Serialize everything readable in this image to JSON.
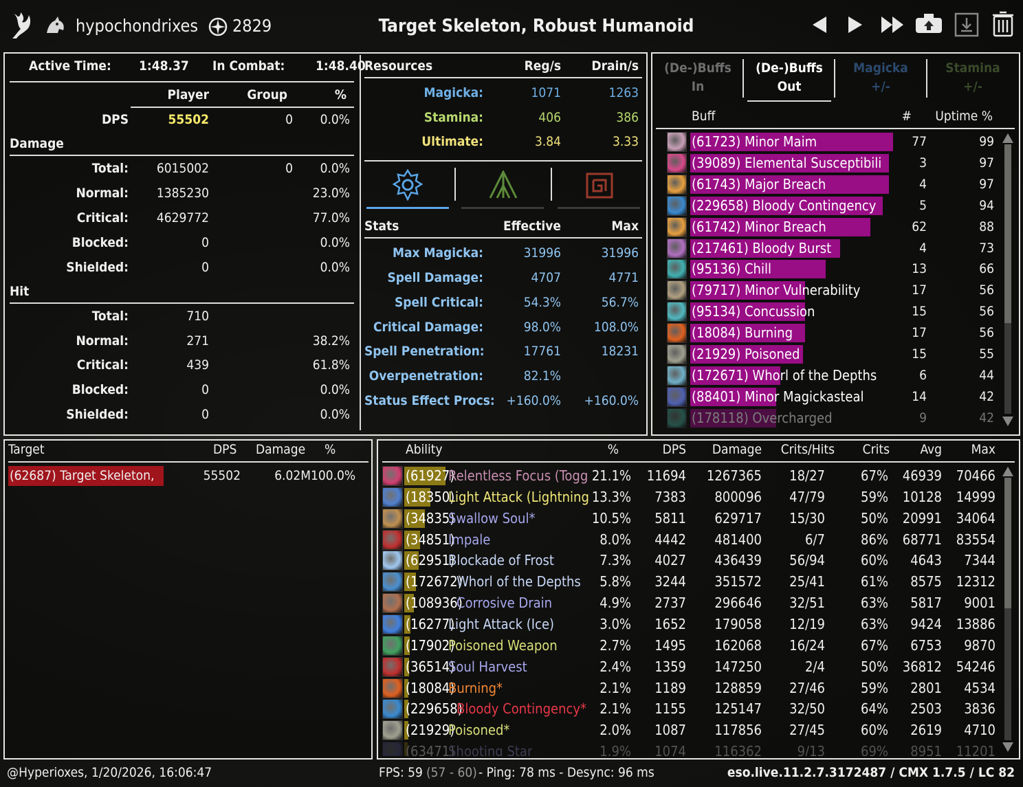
{
  "header": {
    "player_name": "hypochondrixes",
    "champion_points": "2829",
    "target_title": "Target Skeleton, Robust Humanoid",
    "icons": [
      "class-logo-icon",
      "mount-icon",
      "champion-star-icon",
      "previous-fight-icon",
      "next-fight-icon",
      "latest-fight-icon",
      "upload-icon",
      "save-icon",
      "trash-icon"
    ]
  },
  "summary": {
    "active_time_label": "Active Time:",
    "active_time": "1:48.37",
    "in_combat_label": "In Combat:",
    "in_combat": "1:48.40",
    "col_player": "Player",
    "col_group": "Group",
    "col_pct": "%",
    "dps_label": "DPS",
    "dps_player": "55502",
    "dps_group": "0",
    "dps_pct": "0.0%",
    "damage_section": "Damage",
    "damage": [
      {
        "label": "Total:",
        "player": "6015002",
        "group": "0",
        "pct": "0.0%"
      },
      {
        "label": "Normal:",
        "player": "1385230",
        "group": "",
        "pct": "23.0%"
      },
      {
        "label": "Critical:",
        "player": "4629772",
        "group": "",
        "pct": "77.0%"
      },
      {
        "label": "Blocked:",
        "player": "0",
        "group": "",
        "pct": "0.0%"
      },
      {
        "label": "Shielded:",
        "player": "0",
        "group": "",
        "pct": "0.0%"
      }
    ],
    "hit_section": "Hit",
    "hits": [
      {
        "label": "Total:",
        "player": "710",
        "pct": ""
      },
      {
        "label": "Normal:",
        "player": "271",
        "pct": "38.2%"
      },
      {
        "label": "Critical:",
        "player": "439",
        "pct": "61.8%"
      },
      {
        "label": "Blocked:",
        "player": "0",
        "pct": "0.0%"
      },
      {
        "label": "Shielded:",
        "player": "0",
        "pct": "0.0%"
      }
    ]
  },
  "resources": {
    "header": "Resources",
    "col_reg": "Reg/s",
    "col_drain": "Drain/s",
    "rows": [
      {
        "label": "Magicka:",
        "reg": "1071",
        "drain": "1263"
      },
      {
        "label": "Stamina:",
        "reg": "406",
        "drain": "386"
      },
      {
        "label": "Ultimate:",
        "reg": "3.84",
        "drain": "3.33"
      }
    ],
    "tabs": [
      "magicka-stats-tab",
      "stamina-stats-tab",
      "resistance-stats-tab"
    ]
  },
  "stats": {
    "header": "Stats",
    "col_effective": "Effective",
    "col_max": "Max",
    "rows": [
      {
        "label": "Max Magicka:",
        "effective": "31996",
        "max": "31996"
      },
      {
        "label": "Spell Damage:",
        "effective": "4707",
        "max": "4771"
      },
      {
        "label": "Spell Critical:",
        "effective": "54.3%",
        "max": "56.7%"
      },
      {
        "label": "Critical Damage:",
        "effective": "98.0%",
        "max": "108.0%"
      },
      {
        "label": "Spell Penetration:",
        "effective": "17761",
        "max": "18231"
      },
      {
        "label": "Overpenetration:",
        "effective": "82.1%",
        "max": ""
      },
      {
        "label": "Status Effect Procs:",
        "effective": "+160.0%",
        "max": "+160.0%"
      }
    ]
  },
  "buffs": {
    "tabs": [
      {
        "line1": "(De-)Buffs",
        "line2": "In",
        "active": false
      },
      {
        "line1": "(De-)Buffs",
        "line2": "Out",
        "active": true
      },
      {
        "line1": "Magicka",
        "line2": "+/-",
        "active": false
      },
      {
        "line1": "Stamina",
        "line2": "+/-",
        "active": false
      }
    ],
    "col_buff": "Buff",
    "col_count": "#",
    "col_uptime": "Uptime %",
    "rows": [
      {
        "name": "(61723) Minor Maim",
        "count": "77",
        "uptime": "99",
        "icon_color": "#c8a0b8"
      },
      {
        "name": "(39089) Elemental Susceptibili",
        "count": "3",
        "uptime": "97",
        "icon_color": "#d84a8a"
      },
      {
        "name": "(61743) Major Breach",
        "count": "4",
        "uptime": "97",
        "icon_color": "#e8a040"
      },
      {
        "name": "(229658) Bloody Contingency",
        "count": "5",
        "uptime": "94",
        "icon_color": "#3a8ad0"
      },
      {
        "name": "(61742) Minor Breach",
        "count": "62",
        "uptime": "88",
        "icon_color": "#e8a040"
      },
      {
        "name": "(217461) Bloody Burst",
        "count": "4",
        "uptime": "73",
        "icon_color": "#b070c0"
      },
      {
        "name": "(95136) Chill",
        "count": "13",
        "uptime": "66",
        "icon_color": "#40b0b0"
      },
      {
        "name": "(79717) Minor Vulnerability",
        "count": "17",
        "uptime": "56",
        "icon_color": "#b0a080"
      },
      {
        "name": "(95134) Concussion",
        "count": "15",
        "uptime": "56",
        "icon_color": "#50b8c0"
      },
      {
        "name": "(18084) Burning",
        "count": "17",
        "uptime": "56",
        "icon_color": "#e06020"
      },
      {
        "name": "(21929) Poisoned",
        "count": "15",
        "uptime": "55",
        "icon_color": "#a0a090"
      },
      {
        "name": "(172671) Whorl of the Depths",
        "count": "6",
        "uptime": "44",
        "icon_color": "#70b0c8"
      },
      {
        "name": "(88401) Minor Magickasteal",
        "count": "14",
        "uptime": "42",
        "icon_color": "#5060b0"
      },
      {
        "name": "(178118) Overcharged",
        "count": "9",
        "uptime": "42",
        "icon_color": "#40a090"
      }
    ]
  },
  "targets": {
    "col_target": "Target",
    "col_dps": "DPS",
    "col_damage": "Damage",
    "col_pct": "%",
    "rows": [
      {
        "name": "(62687) Target Skeleton,",
        "dps": "55502",
        "damage": "6.02M",
        "pct": "100.0%"
      }
    ]
  },
  "abilities": {
    "col_ability": "Ability",
    "col_pct": "%",
    "col_dps": "DPS",
    "col_damage": "Damage",
    "col_crithits": "Crits/Hits",
    "col_crits": "Crits",
    "col_avg": "Avg",
    "col_max": "Max",
    "rows": [
      {
        "id": "(61927)",
        "name": "Relentless Focus (Togg",
        "color": "#c98fb3",
        "pct": "21.1%",
        "dps": "11694",
        "damage": "1267365",
        "crithits": "18/27",
        "crits": "67%",
        "avg": "46939",
        "max": "70466",
        "icon_color": "#d04070"
      },
      {
        "id": "(18350)",
        "name": "Light Attack (Lightning)",
        "color": "#f2ea78",
        "pct": "13.3%",
        "dps": "7383",
        "damage": "800096",
        "crithits": "47/79",
        "crits": "59%",
        "avg": "10128",
        "max": "14999",
        "icon_color": "#5080d0"
      },
      {
        "id": "(34835)",
        "name": "Swallow Soul*",
        "color": "#a8a8ee",
        "pct": "10.5%",
        "dps": "5811",
        "damage": "629717",
        "crithits": "15/30",
        "crits": "50%",
        "avg": "20991",
        "max": "34064",
        "icon_color": "#c09050"
      },
      {
        "id": "(34851)",
        "name": "Impale",
        "color": "#a8a8ee",
        "pct": "8.0%",
        "dps": "4442",
        "damage": "481400",
        "crithits": "6/7",
        "crits": "86%",
        "avg": "68771",
        "max": "83554",
        "icon_color": "#c03030"
      },
      {
        "id": "(62951)",
        "name": "Blockade of Frost",
        "color": "#c8d8f8",
        "pct": "7.3%",
        "dps": "4027",
        "damage": "436439",
        "crithits": "56/94",
        "crits": "60%",
        "avg": "4643",
        "max": "7344",
        "icon_color": "#a0c8f0"
      },
      {
        "id": "(172672)",
        "name": "Whorl of the Depths",
        "color": "#c8d8f8",
        "pct": "5.8%",
        "dps": "3244",
        "damage": "351572",
        "crithits": "25/41",
        "crits": "61%",
        "avg": "8575",
        "max": "12312",
        "icon_color": "#4a90d0"
      },
      {
        "id": "(108936)",
        "name": "Corrosive Drain",
        "color": "#a8a8ee",
        "pct": "4.9%",
        "dps": "2737",
        "damage": "296646",
        "crithits": "32/51",
        "crits": "63%",
        "avg": "5817",
        "max": "9001",
        "icon_color": "#b07050"
      },
      {
        "id": "(16277)",
        "name": "Light Attack (Ice)",
        "color": "#c8d8f8",
        "pct": "3.0%",
        "dps": "1652",
        "damage": "179058",
        "crithits": "12/19",
        "crits": "63%",
        "avg": "9424",
        "max": "13886",
        "icon_color": "#4080e0"
      },
      {
        "id": "(17902)",
        "name": "Poisoned Weapon",
        "color": "#d8e078",
        "pct": "2.7%",
        "dps": "1495",
        "damage": "162068",
        "crithits": "16/24",
        "crits": "67%",
        "avg": "6753",
        "max": "9870",
        "icon_color": "#40a060"
      },
      {
        "id": "(36514)",
        "name": "Soul Harvest",
        "color": "#a8a8ee",
        "pct": "2.4%",
        "dps": "1359",
        "damage": "147250",
        "crithits": "2/4",
        "crits": "50%",
        "avg": "36812",
        "max": "54246",
        "icon_color": "#c03030"
      },
      {
        "id": "(18084)",
        "name": "Burning*",
        "color": "#f08838",
        "pct": "2.1%",
        "dps": "1189",
        "damage": "128859",
        "crithits": "27/46",
        "crits": "59%",
        "avg": "2801",
        "max": "4534",
        "icon_color": "#e06020"
      },
      {
        "id": "(229658)",
        "name": "Bloody Contingency*",
        "color": "#e83848",
        "pct": "2.1%",
        "dps": "1155",
        "damage": "125147",
        "crithits": "32/50",
        "crits": "64%",
        "avg": "2503",
        "max": "3836",
        "icon_color": "#3a8ad0"
      },
      {
        "id": "(21929)",
        "name": "Poisoned*",
        "color": "#d8e078",
        "pct": "2.0%",
        "dps": "1087",
        "damage": "117856",
        "crithits": "27/45",
        "crits": "60%",
        "avg": "2619",
        "max": "4710",
        "icon_color": "#a0a090"
      },
      {
        "id": "(63471)",
        "name": "Shooting Star",
        "color": "#a8a8ee",
        "pct": "1.9%",
        "dps": "1074",
        "damage": "116362",
        "crithits": "9/13",
        "crits": "69%",
        "avg": "8951",
        "max": "11201",
        "icon_color": "#6060a0"
      }
    ]
  },
  "footer": {
    "account": "@Hyperioxes, 1/20/2026, 16:06:47",
    "fps": "FPS: 59",
    "fps_range": "(57 - 60)",
    "net": "- Ping: 78 ms - Desync: 96 ms",
    "version": "eso.live.11.2.7.3172487 / CMX 1.7.5 / LC 82"
  },
  "colors": {
    "buff_bar": "#990d85",
    "ability_bar": "#8c7a16",
    "target_bar": "#a0141c",
    "magicka": "#6fb0e6",
    "stamina": "#b8d86e",
    "ultimate": "#f0e07a",
    "stat_label": "#8fc4f0",
    "dps_value": "#f5e96a"
  }
}
